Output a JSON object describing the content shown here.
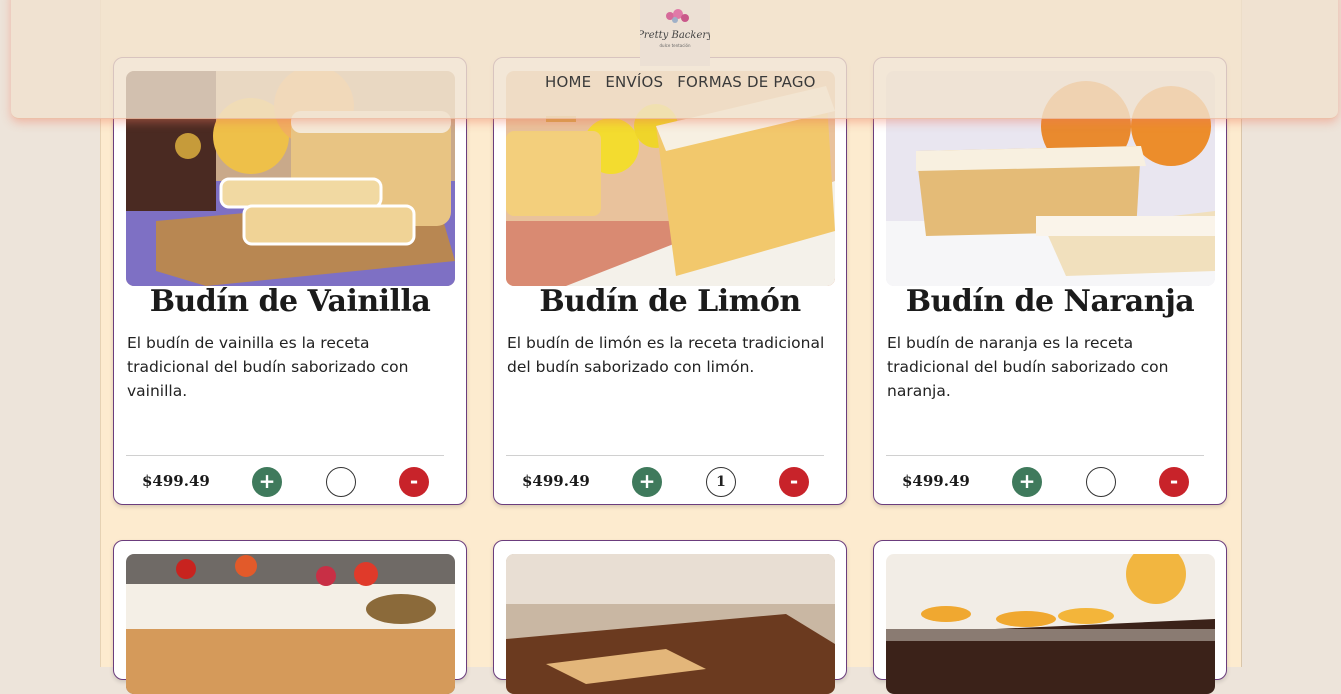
{
  "brand": {
    "logo_text": "Pretty Backery",
    "logo_subtext": "dulce tentación"
  },
  "nav": {
    "items": [
      "HOME",
      "ENVÍOS",
      "FORMAS DE PAGO"
    ]
  },
  "products": [
    {
      "title": "Budín de Vainilla",
      "description": "El budín de vainilla es la receta tradicional del budín saborizado con vainilla.",
      "price": "$499.49",
      "quantity": ""
    },
    {
      "title": "Budín de Limón",
      "description": "El budín de limón es la receta tradicional del budín saborizado con limón.",
      "price": "$499.49",
      "quantity": "1"
    },
    {
      "title": "Budín de Naranja",
      "description": "El budín de naranja es la receta tradicional del budín saborizado con naranja.",
      "price": "$499.49",
      "quantity": ""
    }
  ],
  "buttons": {
    "plus": "+",
    "minus": "-"
  },
  "colors": {
    "plus": "#3f7a5c",
    "minus": "#c8232a",
    "card_border": "#6b3d7d",
    "page_bg": "#fdebcf"
  }
}
